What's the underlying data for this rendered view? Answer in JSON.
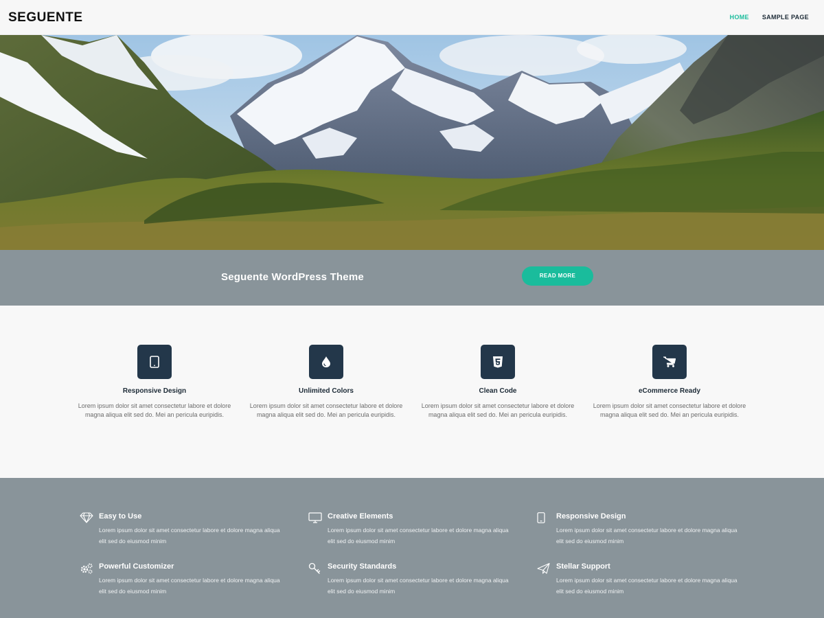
{
  "header": {
    "logo": "SEGUENTE",
    "nav": [
      {
        "label": "HOME",
        "active": true
      },
      {
        "label": "SAMPLE PAGE",
        "active": false
      }
    ]
  },
  "banner": {
    "title": "Seguente WordPress Theme",
    "button_label": "READ MORE"
  },
  "features": [
    {
      "icon": "tablet-icon",
      "title": "Responsive Design",
      "text": "Lorem ipsum dolor sit amet consectetur labore et dolore magna aliqua elit sed do. Mei an pericula euripidis."
    },
    {
      "icon": "droplet-icon",
      "title": "Unlimited Colors",
      "text": "Lorem ipsum dolor sit amet consectetur labore et dolore magna aliqua elit sed do. Mei an pericula euripidis."
    },
    {
      "icon": "html5-icon",
      "title": "Clean Code",
      "text": "Lorem ipsum dolor sit amet consectetur labore et dolore magna aliqua elit sed do. Mei an pericula euripidis."
    },
    {
      "icon": "cart-icon",
      "title": "eCommerce Ready",
      "text": "Lorem ipsum dolor sit amet consectetur labore et dolore magna aliqua elit sed do. Mei an pericula euripidis."
    }
  ],
  "bottom_features": [
    {
      "icon": "diamond-icon",
      "title": "Easy to Use",
      "text": "Lorem ipsum dolor sit amet consectetur labore et dolore magna aliqua elit sed do eiusmod minim"
    },
    {
      "icon": "monitor-icon",
      "title": "Creative Elements",
      "text": "Lorem ipsum dolor sit amet consectetur labore et dolore magna aliqua elit sed do eiusmod minim"
    },
    {
      "icon": "mobile-icon",
      "title": "Responsive Design",
      "text": "Lorem ipsum dolor sit amet consectetur labore et dolore magna aliqua elit sed do eiusmod minim"
    },
    {
      "icon": "gears-icon",
      "title": "Powerful Customizer",
      "text": "Lorem ipsum dolor sit amet consectetur labore et dolore magna aliqua elit sed do eiusmod minim"
    },
    {
      "icon": "key-icon",
      "title": "Security Standards",
      "text": "Lorem ipsum dolor sit amet consectetur labore et dolore magna aliqua elit sed do eiusmod minim"
    },
    {
      "icon": "paper-plane-icon",
      "title": "Stellar Support",
      "text": "Lorem ipsum dolor sit amet consectetur labore et dolore magna aliqua elit sed do eiusmod minim"
    }
  ],
  "colors": {
    "accent": "#1abc9c",
    "dark_icon_bg": "#23374a",
    "band_gray": "#89949a",
    "page_bg": "#f8f8f8"
  }
}
